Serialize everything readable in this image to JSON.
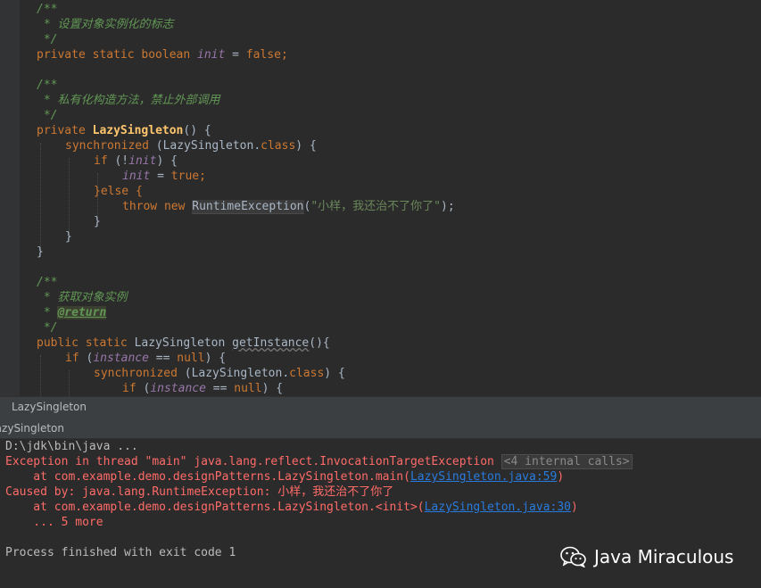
{
  "editor": {
    "lines": [
      {
        "text": "/**"
      },
      {
        "text": " * 设置对象实例化的标志"
      },
      {
        "text": " */"
      },
      {
        "kw1": "private static boolean ",
        "field": "init",
        "op": " = ",
        "kw2": "false",
        "end": ";"
      },
      {
        "text": "/**"
      },
      {
        "text": " * 私有化构造方法，禁止外部调用"
      },
      {
        "text": " */"
      },
      {
        "kw1": "private ",
        "name": "LazySingleton",
        "end": "() {"
      },
      {
        "kw1": "synchronized ",
        "mid": "(LazySingleton.",
        "kw2": "class",
        "end": ") {"
      },
      {
        "kw1": "if ",
        "mid": "(!",
        "field": "init",
        "end": ") {"
      },
      {
        "field": "init",
        "op": " = ",
        "kw2": "true",
        "end": ";"
      },
      {
        "text": "}else {",
        "kw": "else"
      },
      {
        "kw1": "throw new ",
        "cls": "RuntimeException",
        "open": "(",
        "str": "\"小样，我还治不了你了\"",
        "end": ");"
      },
      {
        "text": "}"
      },
      {
        "text": "}"
      },
      {
        "text": "}"
      },
      {
        "text": "/**"
      },
      {
        "text": " * 获取对象实例"
      },
      {
        "text": " * ",
        "tag": "@return"
      },
      {
        "text": " */"
      },
      {
        "kw1": "public static ",
        "mid": "LazySingleton ",
        "warn": "getInstance",
        "end": "(){"
      },
      {
        "kw1": "if ",
        "mid": "(",
        "field": "instance",
        "op": " == ",
        "kw2": "null",
        "end": ") {"
      },
      {
        "kw1": "synchronized ",
        "mid": "(LazySingleton.",
        "kw2": "class",
        "end": ") {"
      },
      {
        "kw1": "if ",
        "mid": "(",
        "field": "instance",
        "op": " == ",
        "kw2": "null",
        "end": ") {"
      }
    ]
  },
  "run_panel": {
    "title": "LazySingleton",
    "tab_label": "LazySingleton"
  },
  "console": {
    "command": "D:\\jdk\\bin\\java ...",
    "exception": "Exception in thread \"main\" java.lang.reflect.InvocationTargetException",
    "internal_calls": "<4 internal calls>",
    "at1_prefix": "    at com.example.demo.designPatterns.LazySingleton.main(",
    "at1_link": "LazySingleton.java:59",
    "at1_suffix": ")",
    "caused_by": "Caused by: java.lang.RuntimeException: 小样，我还治不了你了",
    "at2_prefix": "    at com.example.demo.designPatterns.LazySingleton.<init>(",
    "at2_link": "LazySingleton.java:30",
    "at2_suffix": ")",
    "more": "    ... 5 more",
    "exit": "Process finished with exit code 1"
  },
  "watermark": {
    "text": "Java Miraculous",
    "icon": "wechat-icon"
  }
}
